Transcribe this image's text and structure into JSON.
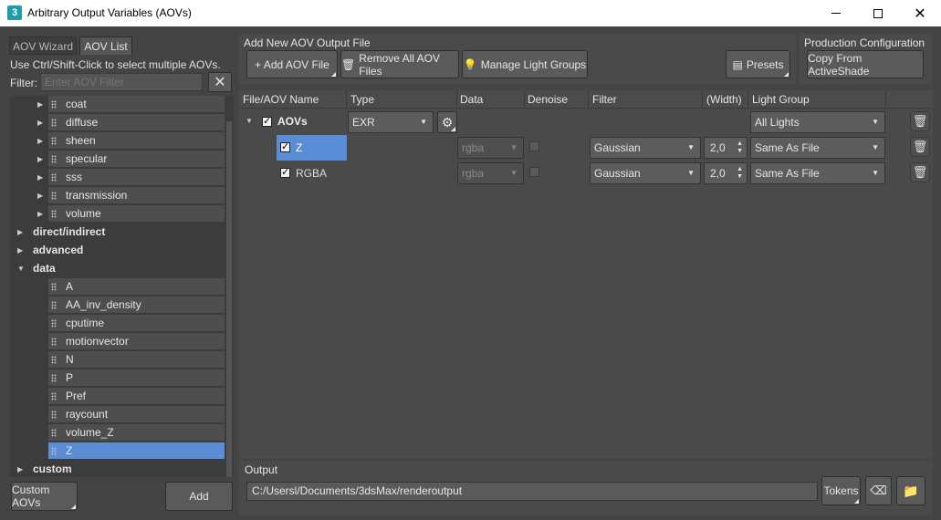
{
  "window": {
    "title": "Arbitrary Output Variables (AOVs)",
    "app_icon": "3"
  },
  "left": {
    "tabs": [
      "AOV Wizard",
      "AOV List"
    ],
    "hint": "Use Ctrl/Shift-Click to select multiple AOVs.",
    "filter_label": "Filter:",
    "filter_placeholder": "Enter AOV Filter",
    "tree": [
      {
        "label": "coat",
        "kind": "child",
        "expandable": true
      },
      {
        "label": "diffuse",
        "kind": "child",
        "expandable": true
      },
      {
        "label": "sheen",
        "kind": "child",
        "expandable": true
      },
      {
        "label": "specular",
        "kind": "child",
        "expandable": true
      },
      {
        "label": "sss",
        "kind": "child",
        "expandable": true
      },
      {
        "label": "transmission",
        "kind": "child",
        "expandable": true
      },
      {
        "label": "volume",
        "kind": "child",
        "expandable": true
      },
      {
        "label": "direct/indirect",
        "kind": "group",
        "open": false
      },
      {
        "label": "advanced",
        "kind": "group",
        "open": false
      },
      {
        "label": "data",
        "kind": "group",
        "open": true
      },
      {
        "label": "A",
        "kind": "child"
      },
      {
        "label": "AA_inv_density",
        "kind": "child"
      },
      {
        "label": "cputime",
        "kind": "child"
      },
      {
        "label": "motionvector",
        "kind": "child"
      },
      {
        "label": "N",
        "kind": "child"
      },
      {
        "label": "P",
        "kind": "child"
      },
      {
        "label": "Pref",
        "kind": "child"
      },
      {
        "label": "raycount",
        "kind": "child"
      },
      {
        "label": "volume_Z",
        "kind": "child"
      },
      {
        "label": "Z",
        "kind": "child",
        "selected": true
      },
      {
        "label": "custom",
        "kind": "group",
        "open": false
      }
    ],
    "custom_aovs_label": "Custom AOVs",
    "add_label": "Add"
  },
  "toolbar": {
    "add_group_label": "Add New AOV Output File",
    "add_aov_file": "+ Add AOV File",
    "remove_all": "Remove All AOV Files",
    "manage_light_groups": "Manage Light Groups",
    "presets": "Presets",
    "prod_group_label": "Production Configuration",
    "copy_from_activeshade": "Copy From ActiveShade"
  },
  "table": {
    "headers": [
      "File/AOV Name",
      "Type",
      "Data",
      "Denoise",
      "Filter",
      "(Width)",
      "Light Group"
    ],
    "file_row": {
      "name": "AOVs",
      "type": "EXR",
      "light_group": "All Lights",
      "checked": true
    },
    "aov_rows": [
      {
        "name": "Z",
        "data": "rgba",
        "filter": "Gaussian",
        "width": "2,0",
        "light_group": "Same As File",
        "checked": true,
        "selected": true
      },
      {
        "name": "RGBA",
        "data": "rgba",
        "filter": "Gaussian",
        "width": "2,0",
        "light_group": "Same As File",
        "checked": true,
        "selected": false
      }
    ]
  },
  "output": {
    "label": "Output",
    "path": "C:/Usersl/Documents/3dsMax/renderoutput",
    "tokens_label": "Tokens"
  },
  "colors": {
    "selection": "#5b8cd6",
    "panel": "#444444",
    "button": "#5a5a5a"
  }
}
